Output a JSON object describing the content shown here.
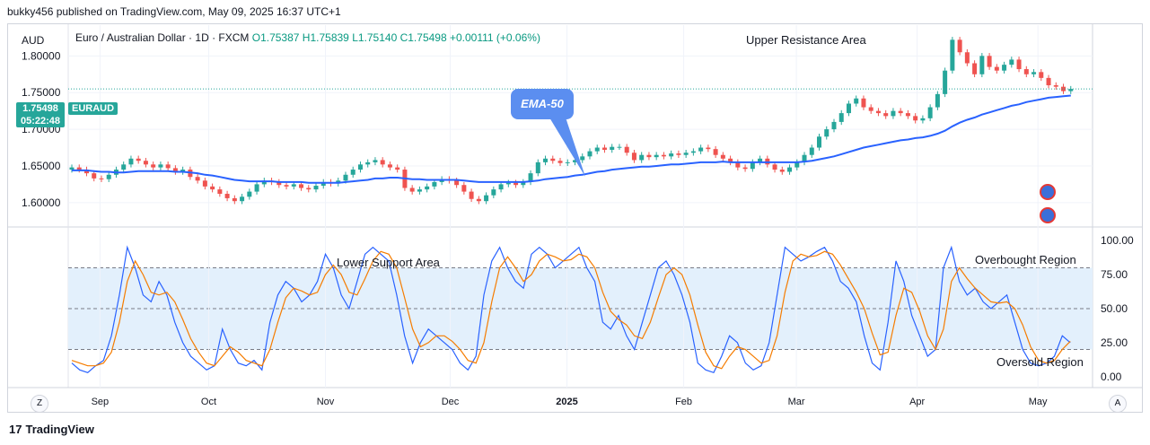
{
  "header": {
    "published": "bukky456 published on TradingView.com, May 09, 2025 16:37 UTC+1"
  },
  "footer": {
    "brand": "TradingView"
  },
  "legend": {
    "currency": "AUD",
    "instrument": "Euro / Australian Dollar · 1D · FXCM",
    "open": "O1.75387",
    "high": "H1.75839",
    "low": "L1.75140",
    "close": "C1.75498",
    "change": "+0.00111 (+0.06%)"
  },
  "price_tag": {
    "price": "1.75498",
    "countdown": "05:22:48",
    "symbol": "EURAUD"
  },
  "annotations": {
    "ema_callout": "EMA-50",
    "upper_resistance": "Upper Resistance Area",
    "lower_support": "Lower Support Area",
    "overbought": "Overbought Region",
    "oversold": "Oversold Region"
  },
  "buttons": {
    "z": "Z",
    "a": "A"
  },
  "colors": {
    "up": "#26a69a",
    "down": "#ef5350",
    "ema": "#2962ff",
    "stoch_k": "#2962ff",
    "stoch_d": "#f57c00",
    "band": "#e3f0fc"
  },
  "chart_data": [
    {
      "type": "candlestick",
      "title": "Euro / Australian Dollar · 1D · FXCM",
      "y_ticks": [
        "1.80000",
        "1.75000",
        "1.70000",
        "1.65000",
        "1.60000"
      ],
      "ylim": [
        1.568,
        1.842
      ],
      "x_ticks": [
        "Sep",
        "Oct",
        "Nov",
        "Dec",
        "2025",
        "Feb",
        "Mar",
        "Apr",
        "May"
      ],
      "x_tick_positions": [
        0.05,
        0.22,
        0.4,
        0.6,
        0.77,
        0.97,
        1.17,
        1.4,
        1.63
      ],
      "grid": true,
      "close_series": [
        1.648,
        1.645,
        1.64,
        1.633,
        1.632,
        1.638,
        1.645,
        1.652,
        1.66,
        1.657,
        1.652,
        1.648,
        1.652,
        1.647,
        1.642,
        1.645,
        1.635,
        1.63,
        1.622,
        1.618,
        1.612,
        1.606,
        1.602,
        1.608,
        1.615,
        1.625,
        1.63,
        1.628,
        1.624,
        1.622,
        1.625,
        1.62,
        1.618,
        1.623,
        1.628,
        1.626,
        1.63,
        1.638,
        1.645,
        1.652,
        1.655,
        1.658,
        1.652,
        1.648,
        1.645,
        1.62,
        1.615,
        1.618,
        1.622,
        1.628,
        1.632,
        1.63,
        1.624,
        1.615,
        1.605,
        1.602,
        1.61,
        1.618,
        1.625,
        1.627,
        1.624,
        1.628,
        1.64,
        1.655,
        1.66,
        1.657,
        1.654,
        1.655,
        1.658,
        1.663,
        1.67,
        1.675,
        1.672,
        1.676,
        1.676,
        1.668,
        1.658,
        1.665,
        1.662,
        1.665,
        1.663,
        1.667,
        1.665,
        1.668,
        1.67,
        1.675,
        1.673,
        1.665,
        1.66,
        1.655,
        1.648,
        1.646,
        1.655,
        1.66,
        1.652,
        1.645,
        1.642,
        1.648,
        1.655,
        1.665,
        1.675,
        1.69,
        1.7,
        1.71,
        1.722,
        1.735,
        1.742,
        1.73,
        1.725,
        1.722,
        1.718,
        1.725,
        1.722,
        1.718,
        1.712,
        1.715,
        1.73,
        1.748,
        1.78,
        1.822,
        1.805,
        1.79,
        1.775,
        1.8,
        1.785,
        1.78,
        1.788,
        1.795,
        1.782,
        1.775,
        1.778,
        1.77,
        1.76,
        1.758,
        1.752,
        1.755
      ],
      "ema50": [
        1.644,
        1.644,
        1.644,
        1.643,
        1.642,
        1.642,
        1.641,
        1.641,
        1.642,
        1.643,
        1.643,
        1.643,
        1.643,
        1.643,
        1.642,
        1.642,
        1.641,
        1.64,
        1.638,
        1.637,
        1.635,
        1.633,
        1.631,
        1.63,
        1.629,
        1.629,
        1.629,
        1.629,
        1.628,
        1.628,
        1.628,
        1.628,
        1.627,
        1.627,
        1.627,
        1.627,
        1.627,
        1.628,
        1.629,
        1.63,
        1.631,
        1.633,
        1.633,
        1.634,
        1.634,
        1.633,
        1.632,
        1.632,
        1.631,
        1.631,
        1.631,
        1.631,
        1.631,
        1.63,
        1.629,
        1.628,
        1.628,
        1.628,
        1.628,
        1.628,
        1.628,
        1.628,
        1.629,
        1.63,
        1.632,
        1.633,
        1.634,
        1.635,
        1.637,
        1.638,
        1.64,
        1.642,
        1.643,
        1.645,
        1.646,
        1.647,
        1.648,
        1.649,
        1.649,
        1.65,
        1.651,
        1.652,
        1.652,
        1.653,
        1.654,
        1.655,
        1.655,
        1.655,
        1.656,
        1.655,
        1.655,
        1.655,
        1.655,
        1.655,
        1.655,
        1.655,
        1.655,
        1.655,
        1.655,
        1.656,
        1.657,
        1.659,
        1.661,
        1.663,
        1.666,
        1.669,
        1.672,
        1.675,
        1.677,
        1.679,
        1.681,
        1.683,
        1.685,
        1.686,
        1.688,
        1.689,
        1.691,
        1.694,
        1.698,
        1.704,
        1.709,
        1.713,
        1.716,
        1.72,
        1.723,
        1.726,
        1.729,
        1.732,
        1.734,
        1.737,
        1.739,
        1.741,
        1.743,
        1.744,
        1.745,
        1.746
      ]
    },
    {
      "type": "line",
      "title": "",
      "y_ticks": [
        "100.00",
        "75.00",
        "50.00",
        "25.00",
        "0.00"
      ],
      "ylim": [
        -8,
        108
      ],
      "levels": [
        80,
        50,
        20
      ],
      "series": [
        {
          "values": [
            10,
            5,
            3,
            8,
            12,
            30,
            60,
            95,
            80,
            60,
            55,
            70,
            60,
            40,
            25,
            15,
            10,
            5,
            8,
            35,
            20,
            10,
            8,
            12,
            5,
            40,
            60,
            70,
            65,
            55,
            60,
            70,
            90,
            80,
            60,
            50,
            70,
            90,
            95,
            90,
            85,
            60,
            30,
            10,
            25,
            35,
            30,
            25,
            20,
            10,
            5,
            15,
            60,
            85,
            95,
            80,
            70,
            65,
            90,
            95,
            90,
            80,
            85,
            90,
            95,
            80,
            70,
            40,
            35,
            45,
            30,
            20,
            40,
            60,
            80,
            85,
            75,
            60,
            40,
            10,
            5,
            3,
            15,
            30,
            25,
            10,
            5,
            8,
            25,
            60,
            95,
            90,
            85,
            88,
            92,
            95,
            85,
            70,
            65,
            55,
            30,
            10,
            5,
            40,
            85,
            70,
            45,
            30,
            15,
            20,
            80,
            95,
            70,
            60,
            65,
            55,
            50,
            55,
            60,
            40,
            20,
            10,
            8,
            10,
            15,
            30,
            25
          ],
          "name": ""
        },
        {
          "values": [
            12,
            10,
            8,
            8,
            10,
            18,
            40,
            70,
            85,
            75,
            62,
            60,
            62,
            55,
            42,
            28,
            18,
            10,
            8,
            15,
            22,
            18,
            12,
            10,
            8,
            20,
            40,
            58,
            65,
            63,
            60,
            62,
            75,
            82,
            75,
            62,
            60,
            72,
            85,
            92,
            90,
            80,
            58,
            35,
            22,
            25,
            30,
            30,
            26,
            20,
            12,
            10,
            25,
            55,
            80,
            88,
            80,
            70,
            75,
            85,
            90,
            88,
            85,
            86,
            90,
            88,
            80,
            62,
            48,
            42,
            38,
            30,
            28,
            40,
            58,
            75,
            80,
            75,
            60,
            38,
            18,
            8,
            6,
            15,
            22,
            20,
            15,
            10,
            12,
            30,
            62,
            85,
            90,
            88,
            89,
            92,
            90,
            82,
            72,
            62,
            50,
            32,
            16,
            18,
            45,
            65,
            62,
            48,
            30,
            20,
            35,
            70,
            80,
            72,
            65,
            60,
            55,
            54,
            55,
            50,
            38,
            22,
            12,
            10,
            12,
            20,
            26
          ],
          "name": ""
        }
      ],
      "note_levels_dashed": true
    }
  ]
}
